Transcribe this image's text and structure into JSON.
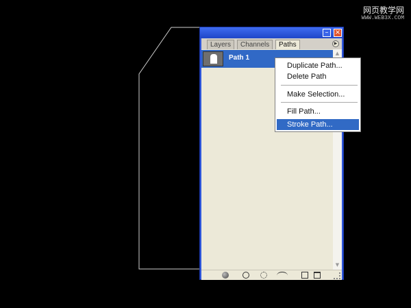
{
  "watermark": {
    "main": "网页教学网",
    "sub": "WWW.WEB3X.COM"
  },
  "panel": {
    "tabs": [
      "Layers",
      "Channels",
      "Paths"
    ],
    "active_tab": "Paths",
    "paths": [
      {
        "name": "Path 1",
        "selected": true
      }
    ],
    "bottom_tools": [
      "fill-path-with-foreground-icon",
      "stroke-path-with-brush-icon",
      "load-path-as-selection-icon",
      "make-work-path-icon",
      "new-path-icon",
      "delete-path-icon"
    ]
  },
  "context_menu": {
    "items": [
      "Duplicate Path...",
      "Delete Path",
      "Make Selection...",
      "Fill Path...",
      "Stroke Path..."
    ],
    "highlighted": "Stroke Path..."
  },
  "colors": {
    "panel_frame": "#2f57d9",
    "selection": "#3169c6",
    "menu_highlight": "#316ac5",
    "panel_bg": "#ece9d8"
  }
}
